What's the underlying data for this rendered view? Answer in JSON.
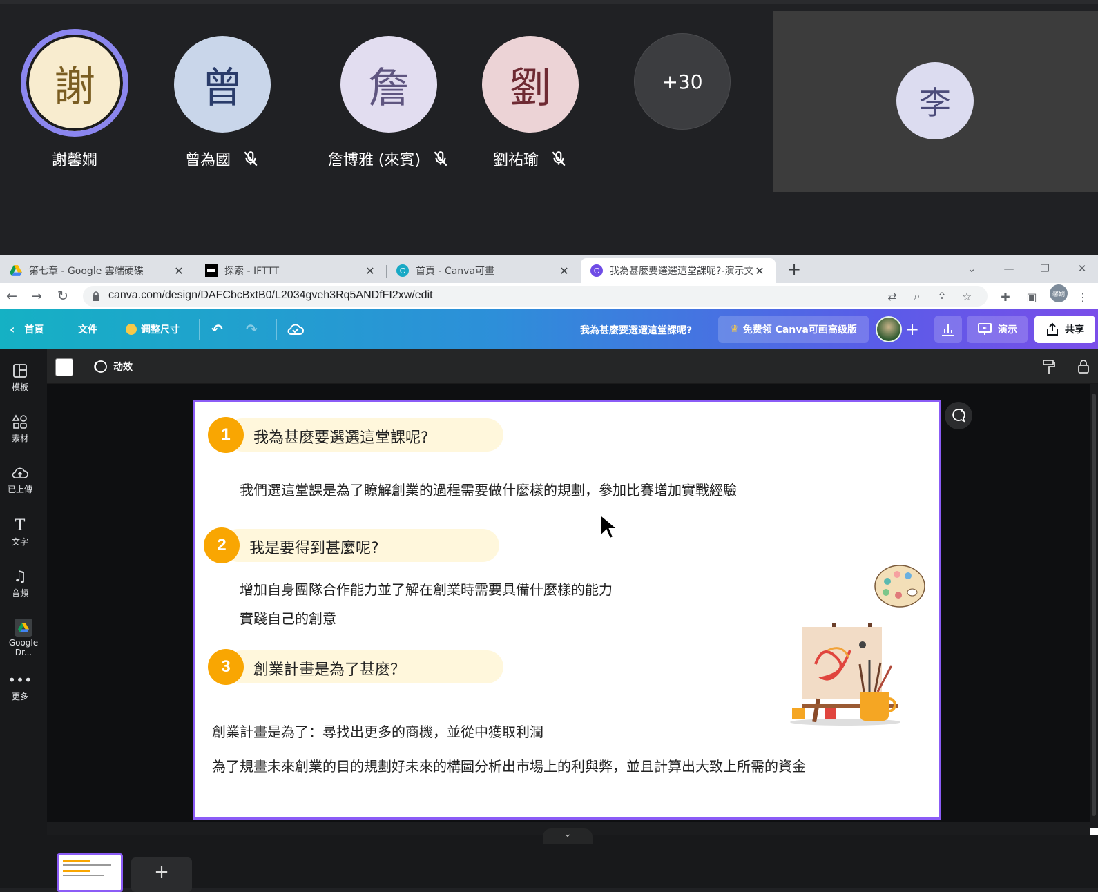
{
  "meeting": {
    "participants": [
      {
        "initial": "謝",
        "name": "謝馨嫺",
        "muted": false,
        "color": "#f8eccf",
        "text_color": "#7a5d22",
        "active": true
      },
      {
        "initial": "曾",
        "name": "曾為國",
        "muted": true,
        "color": "#c9d6ea",
        "text_color": "#2a3c6a"
      },
      {
        "initial": "詹",
        "name": "詹博雅 (來賓)",
        "muted": true,
        "color": "#e2ddf0",
        "text_color": "#5f5580"
      },
      {
        "initial": "劉",
        "name": "劉祐瑜",
        "muted": true,
        "color": "#ecd3d6",
        "text_color": "#6e2a33"
      }
    ],
    "more_count": "+30",
    "self_initial": "李"
  },
  "browser": {
    "tabs": [
      {
        "label": "第七章 - Google 雲端硬碟",
        "favicon": "google-drive-icon"
      },
      {
        "label": "探索 - IFTTT",
        "favicon": "ifttt-icon"
      },
      {
        "label": "首頁 - Canva可畫",
        "favicon": "canva-icon"
      },
      {
        "label": "我為甚麼要選選這堂課呢?-演示文",
        "favicon": "canva-icon",
        "active": true
      }
    ],
    "url": "canva.com/design/DAFCbcBxtB0/L2034gveh3Rq5ANDfFI2xw/edit",
    "profile_label": "馨嫺"
  },
  "canva": {
    "header": {
      "home": "首頁",
      "file": "文件",
      "resize": "调整尺寸",
      "design_title": "我為甚麼要選選這堂課呢?",
      "premium": "免费领 Canva可画高级版",
      "present": "演示",
      "share": "共享"
    },
    "sidebar": [
      {
        "label": "模板",
        "icon": "template-icon"
      },
      {
        "label": "素材",
        "icon": "elements-icon"
      },
      {
        "label": "已上傳",
        "icon": "upload-icon"
      },
      {
        "label": "文字",
        "icon": "text-icon"
      },
      {
        "label": "音頻",
        "icon": "music-icon"
      },
      {
        "label": "Google Dr...",
        "icon": "google-drive-icon"
      },
      {
        "label": "更多",
        "icon": "more-icon"
      }
    ],
    "context_bar": {
      "animate": "动效"
    },
    "slide": {
      "headings": [
        {
          "num": "1",
          "text": "我為甚麼要選選這堂課呢?"
        },
        {
          "num": "2",
          "text": "我是要得到甚麼呢?"
        },
        {
          "num": "3",
          "text": "創業計畫是為了甚麼？"
        }
      ],
      "para1": "我們選這堂課是為了瞭解創業的過程需要做什麼樣的規劃，參加比賽增加實戰經驗",
      "para2_line1": "增加自身團隊合作能力並了解在創業時需要具備什麼樣的能力",
      "para2_line2": "實踐自己的創意",
      "para3_line1": "創業計畫是為了：尋找出更多的商機，並從中獲取利潤",
      "para3_line2": "為了規畫未來創業的目的規劃好未來的構圖分析出市場上的利與弊，並且計算出大致上所需的資金"
    }
  }
}
